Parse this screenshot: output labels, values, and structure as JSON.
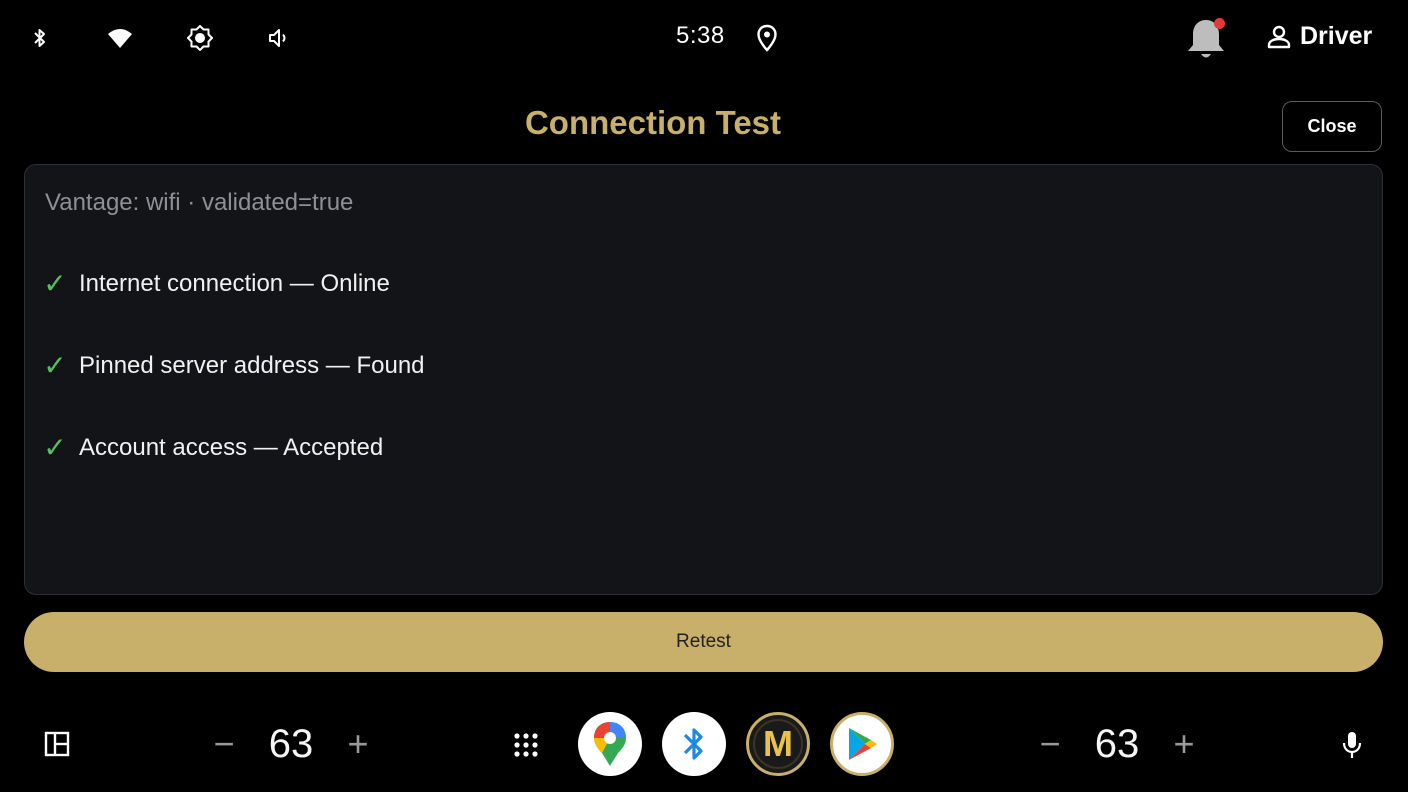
{
  "status_bar": {
    "time": "5:38",
    "icons": [
      "bluetooth-icon",
      "wifi-icon",
      "brightness-icon",
      "volume-icon",
      "location-icon",
      "notification-bell-icon",
      "person-icon"
    ],
    "profile_label": "Driver",
    "notification_dot_color": "#e53935"
  },
  "header": {
    "title": "Connection Test",
    "close_label": "Close"
  },
  "results": {
    "vantage": "Vantage: wifi · validated=true",
    "checks": [
      {
        "mark": "✓",
        "text": "Internet connection — Online"
      },
      {
        "mark": "✓",
        "text": "Pinned server address — Found"
      },
      {
        "mark": "✓",
        "text": "Account access — Accepted"
      }
    ]
  },
  "actions": {
    "retest_label": "Retest"
  },
  "dock": {
    "left_volume": {
      "minus": "−",
      "value": "63",
      "plus": "+"
    },
    "right_volume": {
      "minus": "−",
      "value": "63",
      "plus": "+"
    },
    "apps": [
      "maps-app-icon",
      "bluetooth-app-icon",
      "m-app-icon",
      "play-store-app-icon"
    ],
    "m_app_letter": "M"
  },
  "colors": {
    "accent": "#c8b06a",
    "check": "#55c15e",
    "panel_bg": "#131418",
    "background": "#000000"
  }
}
